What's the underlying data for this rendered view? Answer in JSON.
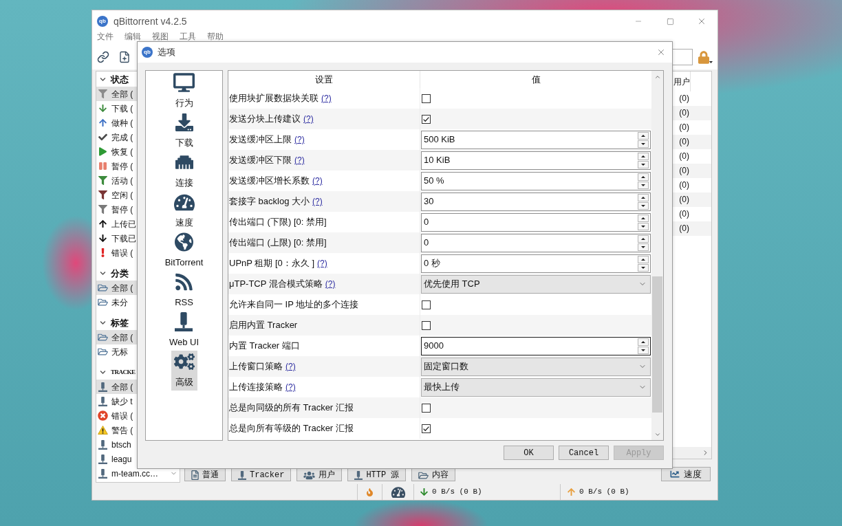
{
  "main_window": {
    "logo": "qb",
    "title": "qBittorrent v4.2.5",
    "menu": [
      "文件",
      "编辑",
      "视图",
      "工具",
      "帮助"
    ],
    "sidebar": [
      {
        "title": "状态",
        "expanded": true,
        "items": [
          {
            "label": "全部 (",
            "selected": true
          },
          {
            "label": "下载 (",
            "selected": false
          },
          {
            "label": "做种 (",
            "selected": false
          },
          {
            "label": "完成 (",
            "selected": false
          },
          {
            "label": "恢复 (",
            "selected": false
          },
          {
            "label": "暂停 (",
            "selected": false
          },
          {
            "label": "活动 (",
            "selected": false
          },
          {
            "label": "空闲 (",
            "selected": false
          },
          {
            "label": "暂停 (",
            "selected": false
          },
          {
            "label": "上传已",
            "selected": false
          },
          {
            "label": "下载已",
            "selected": false
          },
          {
            "label": "错误 (",
            "selected": false
          }
        ]
      },
      {
        "title": "分类",
        "expanded": true,
        "items": [
          {
            "label": "全部 (",
            "selected": true
          },
          {
            "label": "未分",
            "selected": false
          }
        ]
      },
      {
        "title": "标签",
        "expanded": true,
        "items": [
          {
            "label": "全部 (",
            "selected": true
          },
          {
            "label": "无标",
            "selected": false
          }
        ]
      },
      {
        "title": "TRACKE",
        "expanded": true,
        "items": [
          {
            "label": "全部 (",
            "selected": true
          },
          {
            "label": "缺少 t",
            "selected": false
          },
          {
            "label": "错误 (",
            "selected": false
          },
          {
            "label": "警告 (",
            "selected": false
          },
          {
            "label": "btsch",
            "selected": false
          },
          {
            "label": "leagu",
            "selected": false
          },
          {
            "label": "m-team.cc…",
            "selected": false
          }
        ]
      }
    ],
    "torrent_list": {
      "columns": [
        "用户"
      ],
      "rows": [
        [
          "(0)"
        ],
        [
          "(0)"
        ],
        [
          "(0)"
        ],
        [
          "(0)"
        ],
        [
          "(0)"
        ],
        [
          "(0)"
        ],
        [
          "(0)"
        ],
        [
          "(0)"
        ],
        [
          "(0)"
        ],
        [
          "(0)"
        ]
      ]
    },
    "detail_tabs": [
      {
        "label": "普通",
        "selected": false
      },
      {
        "label": "Tracker",
        "selected": false
      },
      {
        "label": "用户",
        "selected": false
      },
      {
        "label": "HTTP 源",
        "selected": false
      },
      {
        "label": "内容",
        "selected": false
      }
    ],
    "speed_button": "速度",
    "status_bar": {
      "download": "0 B/s (0 B)",
      "upload": "0 B/s (0 B)"
    }
  },
  "options_dialog": {
    "logo": "qb",
    "title": "选项",
    "categories": [
      {
        "label": "行为",
        "selected": false
      },
      {
        "label": "下载",
        "selected": false
      },
      {
        "label": "连接",
        "selected": false
      },
      {
        "label": "速度",
        "selected": false
      },
      {
        "label": "BitTorrent",
        "selected": false
      },
      {
        "label": "RSS",
        "selected": false
      },
      {
        "label": "Web UI",
        "selected": false
      },
      {
        "label": "高级",
        "selected": true
      }
    ],
    "table": {
      "columns": [
        "设置",
        "值"
      ],
      "rows": [
        {
          "label": "使用块扩展数据块关联",
          "help": "(?)",
          "kind": "checkbox",
          "checked": false,
          "focused": false
        },
        {
          "label": "发送分块上传建议",
          "help": "(?)",
          "kind": "checkbox",
          "checked": true,
          "focused": false
        },
        {
          "label": "发送缓冲区上限",
          "help": "(?)",
          "kind": "spin",
          "value": "500 KiB",
          "focused": false
        },
        {
          "label": "发送缓冲区下限",
          "help": "(?)",
          "kind": "spin",
          "value": "10 KiB",
          "focused": false
        },
        {
          "label": "发送缓冲区增长系数",
          "help": "(?)",
          "kind": "spin",
          "value": "50 %",
          "focused": false
        },
        {
          "label": "套接字 backlog 大小",
          "help": "(?)",
          "kind": "spin",
          "value": "30",
          "focused": false
        },
        {
          "label": "传出端口 (下限) [0: 禁用]",
          "kind": "spin",
          "value": "0",
          "focused": false
        },
        {
          "label": "传出端口 (上限) [0: 禁用]",
          "kind": "spin",
          "value": "0",
          "focused": false
        },
        {
          "label": "UPnP 租期 [0：永久 ]",
          "help": "(?)",
          "kind": "spin",
          "value": "0 秒",
          "focused": false
        },
        {
          "label": "μTP-TCP 混合模式策略",
          "help": "(?)",
          "kind": "combo",
          "value": "优先使用 TCP",
          "focused": false
        },
        {
          "label": "允许来自同一 IP 地址的多个连接",
          "kind": "checkbox",
          "checked": false,
          "focused": false
        },
        {
          "label": "启用内置 Tracker",
          "kind": "checkbox",
          "checked": false,
          "focused": false
        },
        {
          "label": "内置 Tracker 端口",
          "kind": "spin",
          "value": "9000",
          "focused": true
        },
        {
          "label": "上传窗口策略",
          "help": "(?)",
          "kind": "combo",
          "value": "固定窗口数",
          "focused": false
        },
        {
          "label": "上传连接策略",
          "help": "(?)",
          "kind": "combo",
          "value": "最快上传",
          "focused": false
        },
        {
          "label": "总是向同级的所有 Tracker 汇报",
          "kind": "checkbox",
          "checked": false,
          "focused": false
        },
        {
          "label": "总是向所有等级的 Tracker 汇报",
          "kind": "checkbox",
          "checked": true,
          "focused": false
        }
      ]
    },
    "buttons": [
      {
        "label": "OK",
        "disabled": false
      },
      {
        "label": "Cancel",
        "disabled": false
      },
      {
        "label": "Apply",
        "disabled": true
      }
    ]
  }
}
